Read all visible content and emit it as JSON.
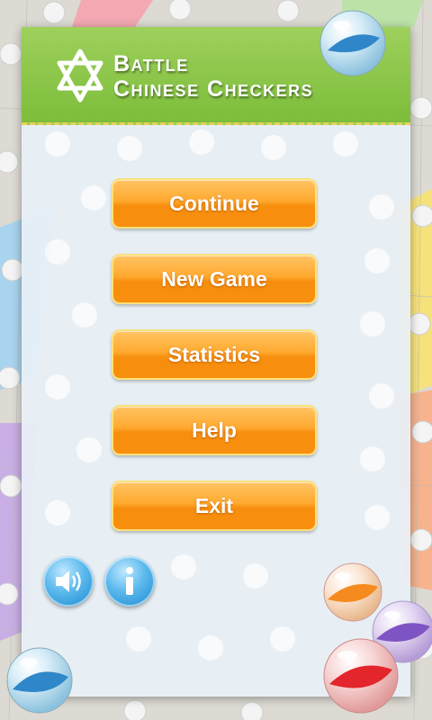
{
  "header": {
    "title_line1": "Battle",
    "title_line2": "Chinese Checkers",
    "logo_icon": "star-of-david-icon"
  },
  "menu": {
    "items": [
      {
        "label": "Continue"
      },
      {
        "label": "New Game"
      },
      {
        "label": "Statistics"
      },
      {
        "label": "Help"
      },
      {
        "label": "Exit"
      }
    ]
  },
  "footer": {
    "sound_icon": "speaker-icon",
    "info_icon": "info-icon"
  },
  "colors": {
    "header_green": "#8cc84b",
    "button_orange": "#ffa92f",
    "accent_blue": "#3aa3e0"
  }
}
